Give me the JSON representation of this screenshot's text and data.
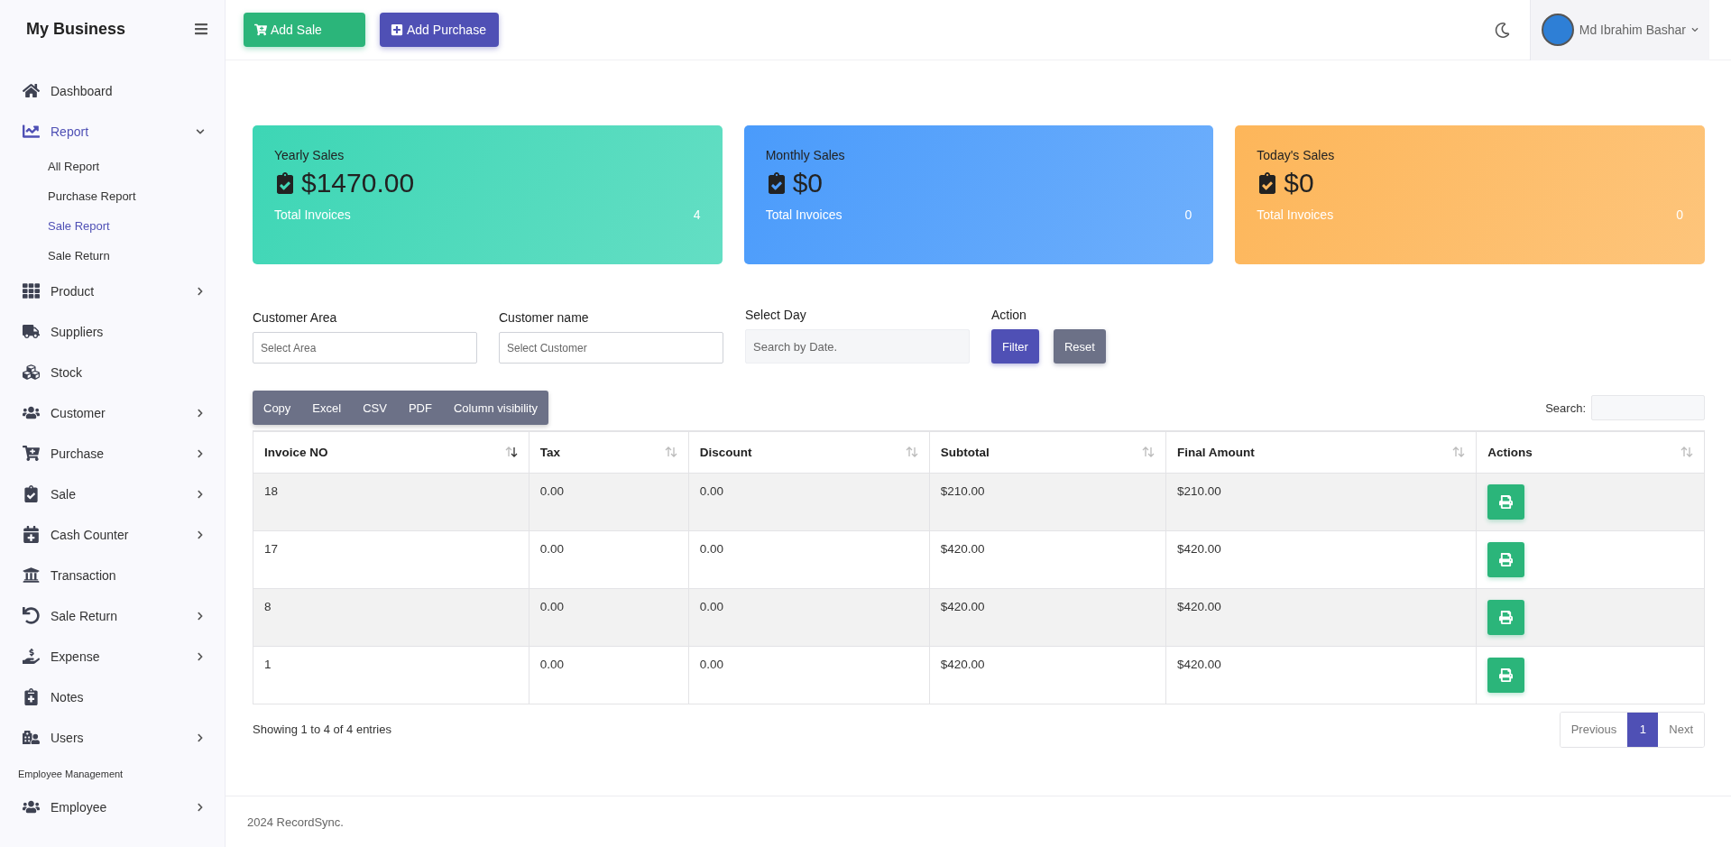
{
  "sidebar": {
    "brand": "My Business",
    "items": [
      {
        "kind": "link",
        "label": "Dashboard",
        "expandable": false,
        "expanded": false,
        "selected": false
      },
      {
        "kind": "link",
        "label": "Report",
        "expandable": true,
        "expanded": true,
        "selected": true,
        "children": [
          {
            "label": "All Report",
            "selected": false
          },
          {
            "label": "Purchase Report",
            "selected": false
          },
          {
            "label": "Sale Report",
            "selected": true
          },
          {
            "label": "Sale Return",
            "selected": false
          }
        ]
      },
      {
        "kind": "link",
        "label": "Product",
        "expandable": true,
        "expanded": false,
        "selected": false
      },
      {
        "kind": "link",
        "label": "Suppliers",
        "expandable": false,
        "expanded": false,
        "selected": false
      },
      {
        "kind": "link",
        "label": "Stock",
        "expandable": false,
        "expanded": false,
        "selected": false
      },
      {
        "kind": "link",
        "label": "Customer",
        "expandable": true,
        "expanded": false,
        "selected": false
      },
      {
        "kind": "link",
        "label": "Purchase",
        "expandable": true,
        "expanded": false,
        "selected": false
      },
      {
        "kind": "link",
        "label": "Sale",
        "expandable": true,
        "expanded": false,
        "selected": false
      },
      {
        "kind": "link",
        "label": "Cash Counter",
        "expandable": true,
        "expanded": false,
        "selected": false
      },
      {
        "kind": "link",
        "label": "Transaction",
        "expandable": false,
        "expanded": false,
        "selected": false
      },
      {
        "kind": "link",
        "label": "Sale Return",
        "expandable": true,
        "expanded": false,
        "selected": false
      },
      {
        "kind": "link",
        "label": "Expense",
        "expandable": true,
        "expanded": false,
        "selected": false
      },
      {
        "kind": "link",
        "label": "Notes",
        "expandable": false,
        "expanded": false,
        "selected": false
      },
      {
        "kind": "link",
        "label": "Users",
        "expandable": true,
        "expanded": false,
        "selected": false
      },
      {
        "kind": "heading",
        "label": "Employee Management"
      },
      {
        "kind": "link",
        "label": "Employee",
        "expandable": true,
        "expanded": false,
        "selected": false
      }
    ]
  },
  "topbar": {
    "buttons": [
      {
        "kind": "sale",
        "label": "Add Sale"
      },
      {
        "kind": "purchase",
        "label": "Add Purchase"
      }
    ],
    "user": {
      "name": "Md Ibrahim Bashar"
    }
  },
  "stats": [
    {
      "title": "Yearly Sales",
      "amount": "$1470.00",
      "caption": "Total Invoices",
      "count": "4",
      "color": "#3dd6b5"
    },
    {
      "title": "Monthly Sales",
      "amount": "$0",
      "caption": "Total Invoices",
      "count": "0",
      "color": "#4a9bfb"
    },
    {
      "title": "Today's Sales",
      "amount": "$0",
      "caption": "Total Invoices",
      "count": "0",
      "color": "#fdb65a"
    }
  ],
  "filters": [
    {
      "kind": "select",
      "label": "Customer Area",
      "placeholder": "Select Area"
    },
    {
      "kind": "select",
      "label": "Customer name",
      "placeholder": "Select Customer"
    },
    {
      "kind": "date",
      "label": "Select Day",
      "placeholder": "Search by Date."
    }
  ],
  "action": {
    "label": "Action",
    "buttons": [
      {
        "kind": "primary",
        "label": "Filter"
      },
      {
        "kind": "secondary",
        "label": "Reset"
      }
    ]
  },
  "export_buttons": [
    "Copy",
    "Excel",
    "CSV",
    "PDF",
    "Column visibility"
  ],
  "search": {
    "label": "Search:"
  },
  "table": {
    "columns": [
      {
        "label": "Invoice NO",
        "sorted_descending": true
      },
      {
        "label": "Tax",
        "sorted_descending": false
      },
      {
        "label": "Discount",
        "sorted_descending": false
      },
      {
        "label": "Subtotal",
        "sorted_descending": false
      },
      {
        "label": "Final Amount",
        "sorted_descending": false
      },
      {
        "label": "Actions",
        "sorted_descending": false
      }
    ],
    "rows": [
      [
        "18",
        "0.00",
        "0.00",
        "$210.00",
        "$210.00"
      ],
      [
        "17",
        "0.00",
        "0.00",
        "$420.00",
        "$420.00"
      ],
      [
        "8",
        "0.00",
        "0.00",
        "$420.00",
        "$420.00"
      ],
      [
        "1",
        "0.00",
        "0.00",
        "$420.00",
        "$420.00"
      ]
    ]
  },
  "info": "Showing 1 to 4 of 4 entries",
  "pagination": [
    {
      "label": "Previous",
      "selected": false
    },
    {
      "label": "1",
      "selected": true
    },
    {
      "label": "Next",
      "selected": false
    }
  ],
  "footer": "2024 RecordSync."
}
